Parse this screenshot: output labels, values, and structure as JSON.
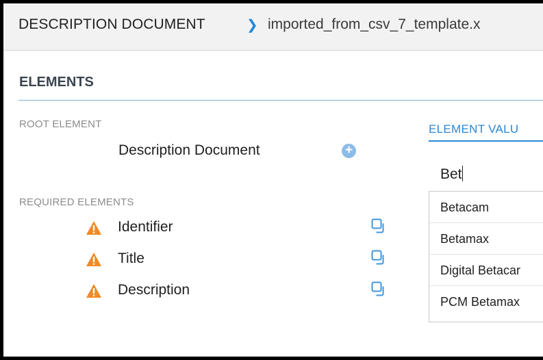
{
  "header": {
    "root_label": "DESCRIPTION DOCUMENT",
    "separator_icon": "chevron-right-icon",
    "file_name": "imported_from_csv_7_template.x"
  },
  "elements": {
    "title": "ELEMENTS",
    "root_section_label": "ROOT ELEMENT",
    "root_element_name": "Description Document",
    "add_icon": "plus-circle-icon",
    "required_section_label": "REQUIRED ELEMENTS",
    "required_items": [
      {
        "label": "Identifier",
        "status_icon": "warning-icon",
        "action_icon": "copy-icon"
      },
      {
        "label": "Title",
        "status_icon": "warning-icon",
        "action_icon": "copy-icon"
      },
      {
        "label": "Description",
        "status_icon": "warning-icon",
        "action_icon": "copy-icon"
      }
    ]
  },
  "element_value": {
    "title": "ELEMENT VALU",
    "input_value": "Bet",
    "suggestions": [
      "Betacam",
      "Betamax",
      "Digital Betacar",
      "PCM Betamax"
    ]
  },
  "colors": {
    "accent": "#2a86d2",
    "warning": "#f08a24",
    "add_button": "#8bbce8",
    "copy_icon": "#3f95dc"
  }
}
